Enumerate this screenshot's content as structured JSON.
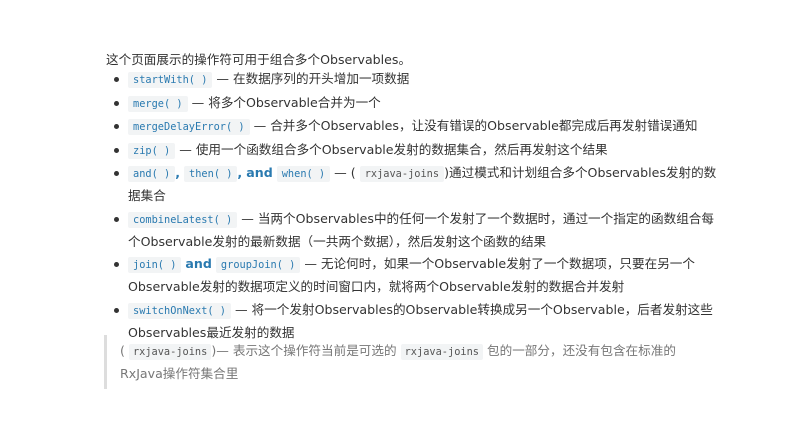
{
  "intro": "这个页面展示的操作符可用于组合多个Observables。",
  "operators": [
    {
      "code1": "startWith( )",
      "desc": "— 在数据序列的开头增加一项数据"
    },
    {
      "code1": "merge( )",
      "desc": "— 将多个Observable合并为一个"
    },
    {
      "code1": "mergeDelayError( )",
      "desc": "— 合并多个Observables，让没有错误的Observable都完成后再发射错误通知"
    },
    {
      "code1": "zip( )",
      "desc": "— 使用一个函数组合多个Observable发射的数据集合，然后再发射这个结果"
    },
    {
      "code1": "and( )",
      "sep1": ",",
      "code2": "then( )",
      "sep2": ",",
      "and_word": "and",
      "code3": "when( )",
      "desc_pre": "— (",
      "inline_code": "rxjava-joins",
      "desc": ")通过模式和计划组合多个Observables发射的数据集合"
    },
    {
      "code1": "combineLatest( )",
      "desc": "— 当两个Observables中的任何一个发射了一个数据时，通过一个指定的函数组合每个Observable发射的最新数据（一共两个数据），然后发射这个函数的结果"
    },
    {
      "code1": "join( )",
      "and_word": "and",
      "code2": "groupJoin( )",
      "desc": "— 无论何时，如果一个Observable发射了一个数据项，只要在另一个Observable发射的数据项定义的时间窗口内，就将两个Observable发射的数据合并发射"
    },
    {
      "code1": "switchOnNext( )",
      "desc": "— 将一个发射Observables的Observable转换成另一个Observable，后者发射这些Observables最近发射的数据"
    }
  ],
  "note": {
    "open": "(",
    "code1": "rxjava-joins",
    "mid": ")— 表示这个操作符当前是可选的",
    "code2": "rxjava-joins",
    "tail": "包的一部分，还没有包含在标准的RxJava操作符集合里"
  }
}
